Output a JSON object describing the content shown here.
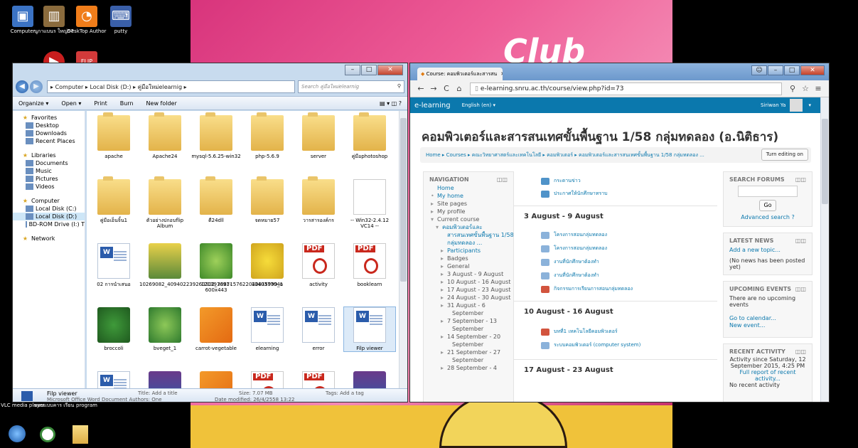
{
  "desktop": {
    "top_icons": [
      {
        "label": "Computer",
        "icon": "computer-icon"
      },
      {
        "label": "นูกาแบนร ใหญ่57",
        "icon": "folder-icon"
      },
      {
        "label": "DeskTop Author",
        "icon": "desktop-author-icon"
      },
      {
        "label": "putty",
        "icon": "putty-icon"
      }
    ],
    "bottom_icons": [
      {
        "label": "VLC media player",
        "icon": "vlc-icon"
      },
      {
        "label": "ขอบแบบคาร เรียน",
        "icon": "app-icon"
      },
      {
        "label": "program",
        "icon": "folder-icon"
      }
    ],
    "wallpaper_text": "Club"
  },
  "explorer": {
    "path": [
      "Computer",
      "Local Disk (D:)",
      "คู่มือใหม่elearnig"
    ],
    "search_placeholder": "Search คู่มือใหม่elearnig",
    "toolbar": [
      "Organize ▾",
      "Open ▾",
      "Print",
      "Burn",
      "New folder"
    ],
    "nav": [
      {
        "label": "Favorites",
        "type": "header",
        "icon": "star-icon"
      },
      {
        "label": "Desktop",
        "type": "item",
        "icon": "desktop-icon"
      },
      {
        "label": "Downloads",
        "type": "item",
        "icon": "downloads-icon"
      },
      {
        "label": "Recent Places",
        "type": "item",
        "icon": "recent-places-icon"
      },
      {
        "label": "",
        "type": "gap"
      },
      {
        "label": "Libraries",
        "type": "header",
        "icon": "libraries-icon"
      },
      {
        "label": "Documents",
        "type": "item",
        "icon": "documents-icon"
      },
      {
        "label": "Music",
        "type": "item",
        "icon": "music-icon"
      },
      {
        "label": "Pictures",
        "type": "item",
        "icon": "pictures-icon"
      },
      {
        "label": "Videos",
        "type": "item",
        "icon": "videos-icon"
      },
      {
        "label": "",
        "type": "gap"
      },
      {
        "label": "Computer",
        "type": "header",
        "icon": "computer-icon"
      },
      {
        "label": "Local Disk (C:)",
        "type": "item",
        "icon": "drive-icon"
      },
      {
        "label": "Local Disk (D:)",
        "type": "selected",
        "icon": "drive-icon"
      },
      {
        "label": "BD-ROM Drive (I:) T",
        "type": "item",
        "icon": "bd-rom-icon"
      },
      {
        "label": "",
        "type": "gap"
      },
      {
        "label": "Network",
        "type": "header",
        "icon": "network-icon"
      }
    ],
    "files": [
      {
        "name": "apache",
        "kind": "folder"
      },
      {
        "name": "Apache24",
        "kind": "folder"
      },
      {
        "name": "mysql-5.6.25-win32",
        "kind": "folder"
      },
      {
        "name": "php-5.6.9",
        "kind": "folder"
      },
      {
        "name": "server",
        "kind": "folder"
      },
      {
        "name": "คู่มือphotoshop",
        "kind": "folder"
      },
      {
        "name": "คู่มือเอ็นจิ้น1",
        "kind": "folder"
      },
      {
        "name": "ตัวอย่างปกอบflip Album",
        "kind": "folder"
      },
      {
        "name": "ดี24dll",
        "kind": "folder"
      },
      {
        "name": "จดหมาย57",
        "kind": "folder"
      },
      {
        "name": "วารสารองค์กร",
        "kind": "folder"
      },
      {
        "name": "-- Win32-2.4.12 VC14 --",
        "kind": "file"
      },
      {
        "name": "02 การนำเสนอ",
        "kind": "doc"
      },
      {
        "name": "10269082_409402239260302_3387157622040035999_o",
        "kind": "photo"
      },
      {
        "name": "121397691-600x443",
        "kind": "lettuce"
      },
      {
        "name": "1340377041",
        "kind": "banana"
      },
      {
        "name": "activity",
        "kind": "pdf"
      },
      {
        "name": "booklearn",
        "kind": "pdf"
      },
      {
        "name": "broccoli",
        "kind": "broccoli"
      },
      {
        "name": "bveget_1",
        "kind": "cabbage"
      },
      {
        "name": "carrot-vegetable",
        "kind": "carrot"
      },
      {
        "name": "elearning",
        "kind": "doc"
      },
      {
        "name": "error",
        "kind": "doc"
      },
      {
        "name": "Filp viewer",
        "kind": "doc"
      },
      {
        "name": "",
        "kind": "doc"
      },
      {
        "name": "",
        "kind": "rar"
      },
      {
        "name": "",
        "kind": "carrot"
      },
      {
        "name": "",
        "kind": "pdf"
      },
      {
        "name": "",
        "kind": "pdf"
      },
      {
        "name": "",
        "kind": "rar"
      }
    ],
    "details": {
      "name": "Filp viewer",
      "type_author": "Microsoft Office Word Document  Authors: One",
      "title": "Title: Add a title",
      "size": "Size: 7.07 MB",
      "date": "Date modified: 26/4/2558 13:22",
      "tags": "Tags: Add a tag"
    }
  },
  "browser": {
    "tab_title": "Course: คอมพิวเตอร์และสารสน",
    "url": "e-learning.snru.ac.th/course/view.php?id=73",
    "site_name": "e-learning",
    "language": "English (en) ▾",
    "user": "Siriwan Ya",
    "course_title": "คอมพิวเตอร์และสารสนเทศขั้นพื้นฐาน 1/58 กลุ่มทดลอง (อ.นิติธาร)",
    "breadcrumb": [
      "Home",
      "Courses",
      "คณะวิทยาศาสตร์และเทคโนโลยี",
      "คอมพิวเตอร์",
      "คอมพิวเตอร์และสารสนเทศขั้นพื้นฐาน 1/58 กลุ่มทดลอง ..."
    ],
    "turn_editing": "Turn editing on",
    "navigation": {
      "title": "NAVIGATION",
      "items": [
        {
          "label": "Home",
          "indent": 0,
          "link": true,
          "mark": ""
        },
        {
          "label": "My home",
          "indent": 0,
          "link": true,
          "mark": "•"
        },
        {
          "label": "Site pages",
          "indent": 0,
          "link": false,
          "mark": "▸"
        },
        {
          "label": "My profile",
          "indent": 0,
          "link": false,
          "mark": "▸"
        },
        {
          "label": "Current course",
          "indent": 0,
          "link": false,
          "mark": "▾"
        },
        {
          "label": "คอมพิวเตอร์และ",
          "indent": 1,
          "link": true,
          "mark": "▾"
        },
        {
          "label": "สารสนเทศขั้นพื้นฐาน 1/58",
          "indent": 2,
          "link": true,
          "mark": ""
        },
        {
          "label": "กลุ่มทดลอง ...",
          "indent": 2,
          "link": true,
          "mark": ""
        },
        {
          "label": "Participants",
          "indent": 2,
          "link": true,
          "mark": "▸"
        },
        {
          "label": "Badges",
          "indent": 2,
          "link": false,
          "mark": "▸"
        },
        {
          "label": "General",
          "indent": 2,
          "link": false,
          "mark": "▸"
        },
        {
          "label": "3 August - 9 August",
          "indent": 2,
          "link": false,
          "mark": "▸"
        },
        {
          "label": "10 August - 16 August",
          "indent": 2,
          "link": false,
          "mark": "▸"
        },
        {
          "label": "17 August - 23 August",
          "indent": 2,
          "link": false,
          "mark": "▸"
        },
        {
          "label": "24 August - 30 August",
          "indent": 2,
          "link": false,
          "mark": "▸"
        },
        {
          "label": "31 August - 6",
          "indent": 2,
          "link": false,
          "mark": "▸"
        },
        {
          "label": "September",
          "indent": 3,
          "link": false,
          "mark": ""
        },
        {
          "label": "7 September - 13",
          "indent": 2,
          "link": false,
          "mark": "▸"
        },
        {
          "label": "September",
          "indent": 3,
          "link": false,
          "mark": ""
        },
        {
          "label": "14 September - 20",
          "indent": 2,
          "link": false,
          "mark": "▸"
        },
        {
          "label": "September",
          "indent": 3,
          "link": false,
          "mark": ""
        },
        {
          "label": "21 September - 27",
          "indent": 2,
          "link": false,
          "mark": "▸"
        },
        {
          "label": "September",
          "indent": 3,
          "link": false,
          "mark": ""
        },
        {
          "label": "28 September - 4",
          "indent": 2,
          "link": false,
          "mark": "▸"
        }
      ]
    },
    "general_items": [
      "กระดานข่าว",
      "ประกาศให้นักศึกษาทราบ"
    ],
    "sections": [
      {
        "title": "3 August - 9 August",
        "items": [
          "โครงการสอนกลุ่มทดลอง",
          "โครงการสอนกลุ่มทดลอง",
          "งานที่นักศึกษาต้องทำ",
          "งานที่นักศึกษาต้องทำ",
          "กิจกรรมการเรียนการสอนกลุ่มทดลอง"
        ]
      },
      {
        "title": "10 August - 16 August",
        "items": [
          "บทที่1 เทคโนโลยีคอมพิวเตอร์",
          "ระบบคอมพิวเตอร์ (computer system)"
        ]
      },
      {
        "title": "17 August - 23 August",
        "items": []
      }
    ],
    "search_forums": {
      "title": "SEARCH FORUMS",
      "go": "Go",
      "advanced": "Advanced search"
    },
    "latest_news": {
      "title": "LATEST NEWS",
      "add": "Add a new topic...",
      "empty": "(No news has been posted yet)"
    },
    "upcoming": {
      "title": "UPCOMING EVENTS",
      "empty": "There are no upcoming events",
      "calendar": "Go to calendar...",
      "new": "New event..."
    },
    "recent": {
      "title": "RECENT ACTIVITY",
      "since1": "Activity since Saturday, 12",
      "since2": "September 2015, 4:25 PM",
      "full": "Full report of recent activity...",
      "none": "No recent activity"
    }
  },
  "colors": {
    "moodle_blue": "#0b78ad",
    "explorer_frame": "#c8dbee"
  }
}
